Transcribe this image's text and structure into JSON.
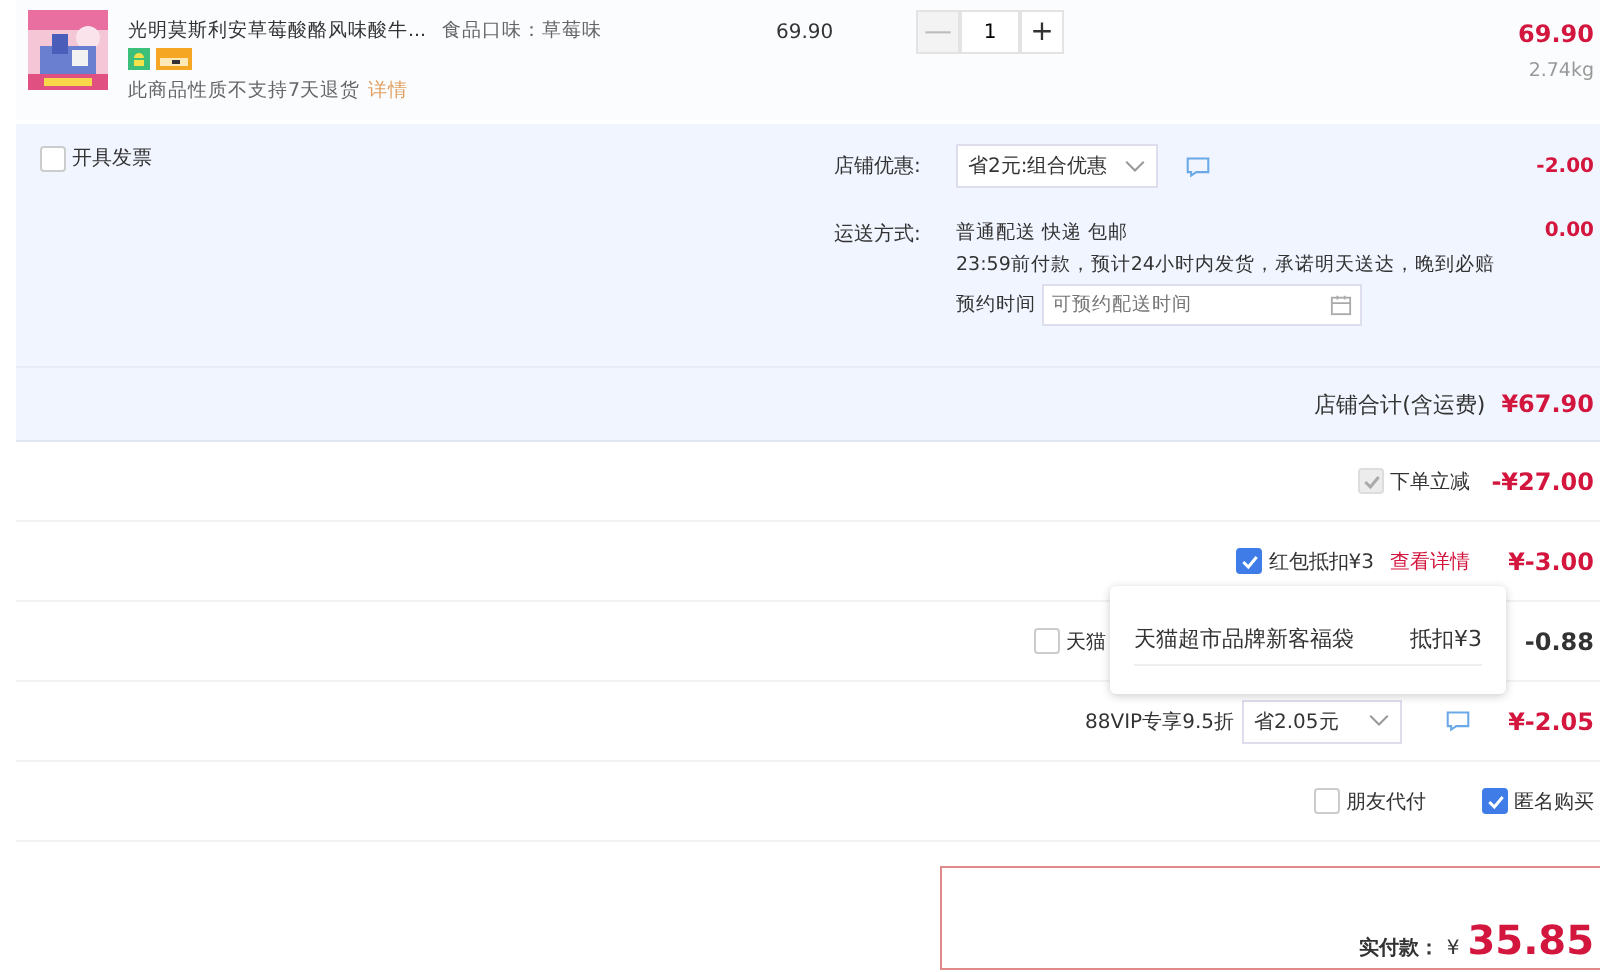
{
  "product": {
    "title": "光明莫斯利安草莓酸酪风味酸牛...",
    "option": "食品口味：草莓味",
    "note": "此商品性质不支持7天退货",
    "note_link": "详情",
    "unit_price": "69.90",
    "quantity": "1",
    "minus": "—",
    "plus": "+",
    "total": "69.90",
    "weight": "2.74kg"
  },
  "invoice": {
    "label": "开具发票",
    "checked": false
  },
  "store_discount": {
    "label": "店铺优惠:",
    "value": "省2元:组合优惠",
    "amount": "-2.00"
  },
  "shipping": {
    "label": "运送方式:",
    "method": "普通配送 快递 包邮",
    "promise": "23:59前付款，预计24小时内发货，承诺明天送达，晚到必赔",
    "schedule_label": "预约时间",
    "schedule_placeholder": "可预约配送时间",
    "amount": "0.00"
  },
  "store_total": {
    "label": "店铺合计(含运费)",
    "amount": "¥67.90"
  },
  "discounts": [
    {
      "kind": "check",
      "label": "下单立减",
      "checked": true,
      "disabled": true,
      "amount": "-¥27.00"
    },
    {
      "kind": "check",
      "label": "红包抵扣¥3",
      "link": "查看详情",
      "checked": true,
      "disabled": false,
      "amount": "¥-3.00"
    },
    {
      "kind": "check",
      "label": "天猫",
      "checked": false,
      "disabled": false,
      "amount": "-0.88"
    },
    {
      "kind": "select",
      "label": "88VIP专享9.5折",
      "value": "省2.05元",
      "amount": "¥-2.05"
    }
  ],
  "popup": {
    "name": "天猫超市品牌新客福袋",
    "value": "抵扣¥3"
  },
  "options": [
    {
      "label": "朋友代付",
      "checked": false
    },
    {
      "label": "匿名购买",
      "checked": true
    }
  ],
  "payment": {
    "label": "实付款：",
    "currency": "¥",
    "amount": "35.85"
  }
}
